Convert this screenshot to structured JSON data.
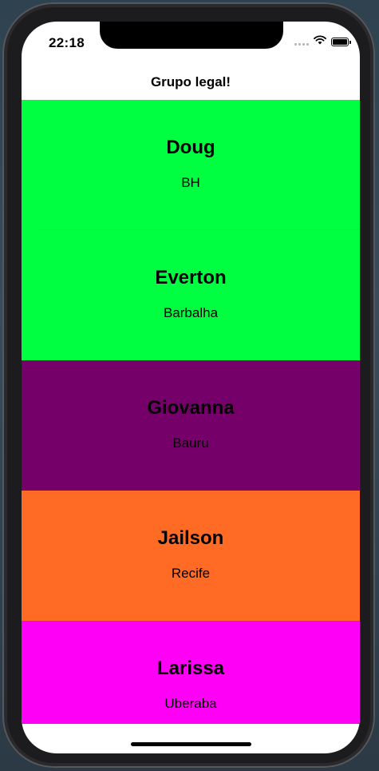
{
  "status_bar": {
    "time": "22:18",
    "icons": [
      "cellular-signal-icon",
      "wifi-icon",
      "battery-icon"
    ]
  },
  "nav": {
    "title": "Grupo legal!"
  },
  "people": [
    {
      "name": "Doug",
      "city": "BH",
      "color": "#00ff40"
    },
    {
      "name": "Everton",
      "city": "Barbalha",
      "color": "#00ff40"
    },
    {
      "name": "Giovanna",
      "city": "Bauru",
      "color": "#76006a"
    },
    {
      "name": "Jailson",
      "city": "Recife",
      "color": "#ff6a25"
    },
    {
      "name": "Larissa",
      "city": "Uberaba",
      "color": "#ff00f7"
    }
  ]
}
